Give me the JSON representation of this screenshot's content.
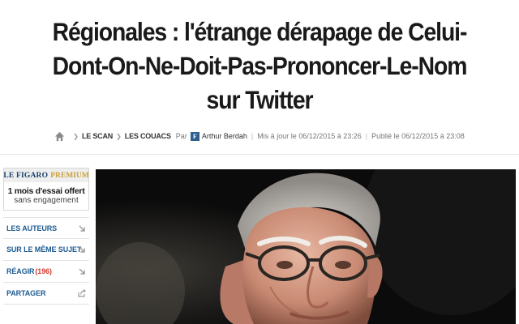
{
  "article": {
    "title": "Régionales : l'étrange dérapage de Celui-Dont-On-Ne-Doit-Pas-Prononcer-Le-Nom sur Twitter"
  },
  "breadcrumb": {
    "items": [
      "LE SCAN",
      "LES COUACS"
    ],
    "by_label": "Par",
    "author": "Arthur Berdah",
    "author_logo_text": "F",
    "updated": "Mis à jour le 06/12/2015 à 23:26",
    "published": "Publié le 06/12/2015 à 23:08"
  },
  "premium": {
    "brand": "LE FIGARO",
    "tier": "PREMIUM",
    "offer": "1 mois d'essai offert",
    "offer_sub": "sans engagement"
  },
  "sidebar": {
    "items": [
      {
        "label": "LES AUTEURS",
        "icon": "arrow-down-right-icon"
      },
      {
        "label": "SUR LE MÊME SUJET",
        "icon": "arrow-down-right-icon"
      },
      {
        "label": "RÉAGIR",
        "count": "(196)",
        "icon": "arrow-down-right-icon"
      },
      {
        "label": "PARTAGER",
        "icon": "share-icon"
      }
    ]
  },
  "colors": {
    "link": "#1d5b91",
    "count": "#d23c2e",
    "premium_gold": "#c9a23c",
    "brand_navy": "#163f6b"
  }
}
